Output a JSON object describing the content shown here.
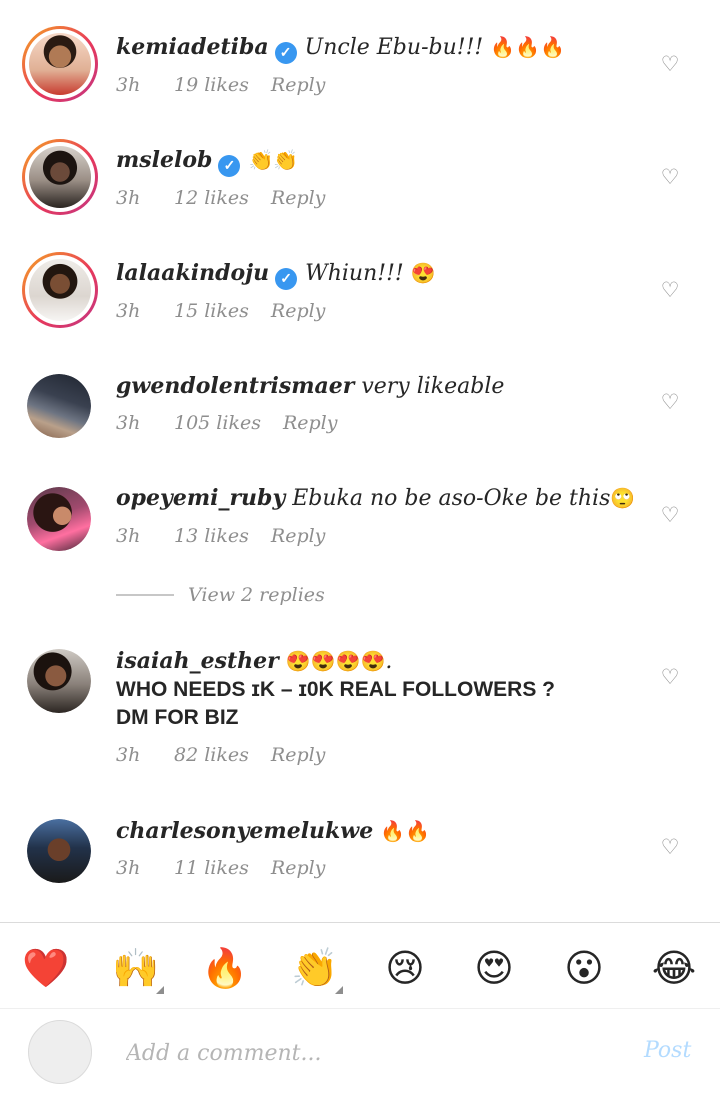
{
  "comments": [
    {
      "username": "kemiadetiba",
      "text": "Uncle Ebu-bu!!!",
      "emoji": "🔥🔥🔥",
      "time": "3h",
      "likes": "19 likes",
      "reply": "Reply"
    },
    {
      "username": "mslelob",
      "text": "",
      "emoji": "👏👏",
      "time": "3h",
      "likes": "12 likes",
      "reply": "Reply"
    },
    {
      "username": "lalaakindoju",
      "text": "Whiun!!!",
      "emoji": "😍",
      "time": "3h",
      "likes": "15 likes",
      "reply": "Reply"
    },
    {
      "username": "gwendolentrismaer",
      "text": "very likeable",
      "emoji": "",
      "time": "3h",
      "likes": "105 likes",
      "reply": "Reply"
    },
    {
      "username": "opeyemi_ruby",
      "text": "Ebuka no be aso-Oke be this",
      "emoji": "🙄",
      "time": "3h",
      "likes": "13 likes",
      "reply": "Reply"
    },
    {
      "username": "isaiah_esther",
      "text": "",
      "emoji": "😍😍😍😍",
      "text_after": ".",
      "spam_line1": "WHO NEEDS ɪK – ɪ0K REAL FOLLOWERS ?",
      "spam_line2": "DM FOR BIZ",
      "time": "3h",
      "likes": "82 likes",
      "reply": "Reply"
    },
    {
      "username": "charlesonyemelukwe",
      "text": "",
      "emoji": "🔥🔥",
      "time": "3h",
      "likes": "11 likes",
      "reply": "Reply"
    }
  ],
  "view_replies_label": "View 2 replies",
  "emoji_bar": [
    "❤️",
    "🙌",
    "🔥",
    "👏",
    "😢",
    "😍",
    "😮",
    "😂"
  ],
  "verified_glyph": "✓",
  "heart_glyph": "♡",
  "composer": {
    "placeholder": "Add a comment...",
    "post_label": "Post"
  }
}
